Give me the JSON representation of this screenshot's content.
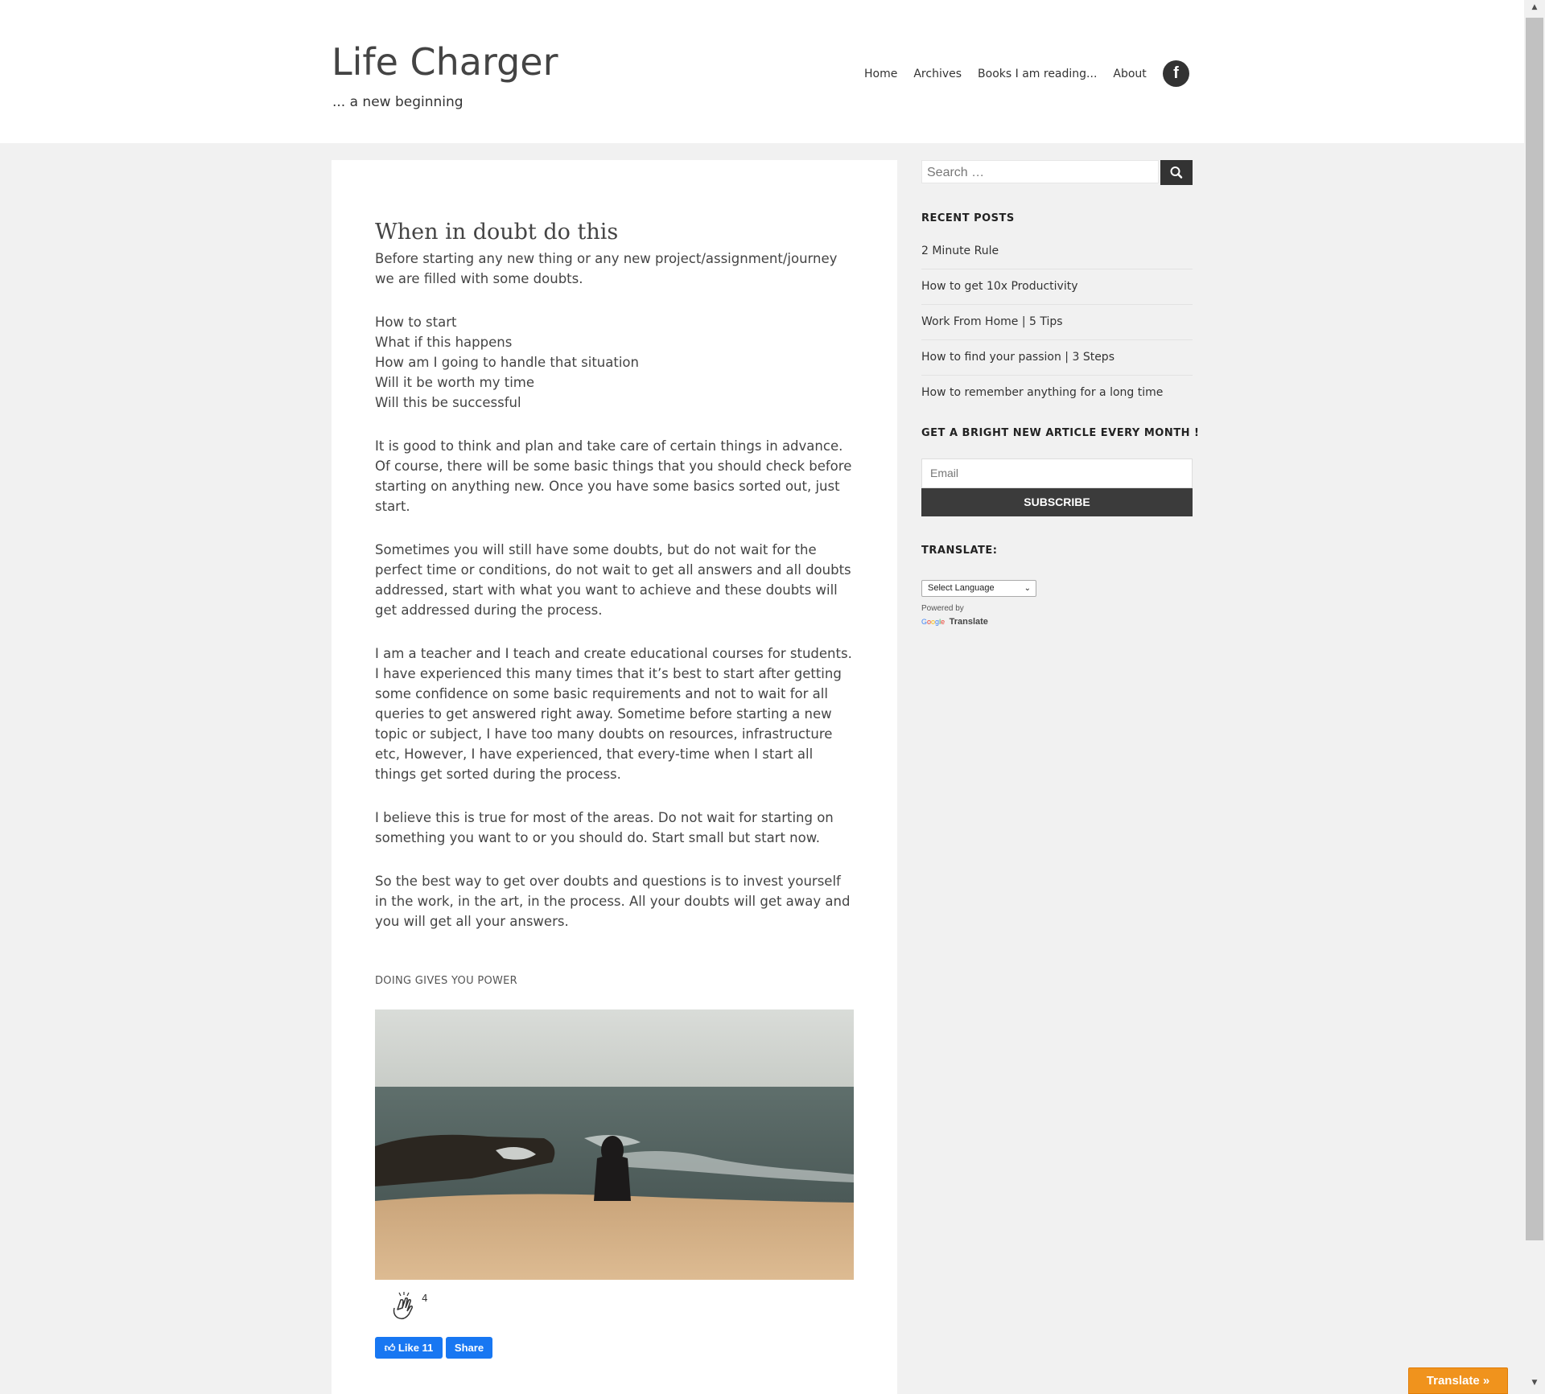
{
  "header": {
    "site_title": "Life Charger",
    "tagline": "... a new beginning",
    "nav": [
      "Home",
      "Archives",
      "Books I am reading...",
      "About"
    ],
    "facebook_icon": "f"
  },
  "post": {
    "title": "When in doubt do this",
    "p1": "Before starting any new thing or any new project/assignment/journey we are filled with some doubts.",
    "doubts": [
      "How to start",
      "What if this happens",
      "How am I going to handle that situation",
      "Will it be worth my time",
      "Will this be successful"
    ],
    "p3": "It is good to think and plan and take care of certain things in advance. Of course, there will be some basic things that you should check before starting on anything new. Once you have some basics sorted out, just start.",
    "p4": "Sometimes you will still have some doubts, but do not wait for the perfect time or conditions, do not wait to get all answers and all doubts addressed, start with what you want to achieve and these doubts will get addressed during the process.",
    "p5": "I am a teacher and I teach and create educational courses for students. I have experienced this many times that it’s best to start after getting some confidence on some basic requirements and not to wait for all queries to get answered right away. Sometime before starting a new topic or subject, I have too many doubts on resources, infrastructure etc, However, I have experienced, that every-time when I start all things get sorted during the process.",
    "p6": "I believe this is true for most of the areas. Do not wait for starting on something you want to or you should do. Start small but start now.",
    "p7": "So the best way to get over doubts and questions is to invest yourself in the work, in the art, in the process. All your doubts will get away and you will get all your answers.",
    "caption": "DOING GIVES YOU POWER",
    "clap_count": "4",
    "fb_like_label": "Like 11",
    "fb_share_label": "Share"
  },
  "sidebar": {
    "search_placeholder": "Search …",
    "recent_posts_title": "RECENT POSTS",
    "recent_posts": [
      "2 Minute Rule",
      "How to get 10x Productivity",
      "Work From Home | 5 Tips",
      "How to find your passion | 3 Steps",
      "How to remember anything for a long time"
    ],
    "newsletter_title": "GET A BRIGHT NEW ARTICLE EVERY MONTH !",
    "email_placeholder": "Email",
    "subscribe_label": "SUBSCRIBE",
    "translate_title": "TRANSLATE:",
    "select_language": "Select Language",
    "powered_by": "Powered by",
    "google": "Google",
    "translate_word": "Translate"
  },
  "floating": {
    "translate_button": "Translate »"
  },
  "colors": {
    "page_bg": "#f1f1f1",
    "dark_button": "#3b3b3b",
    "facebook_blue": "#1877f2",
    "translate_orange": "#f0931d"
  }
}
